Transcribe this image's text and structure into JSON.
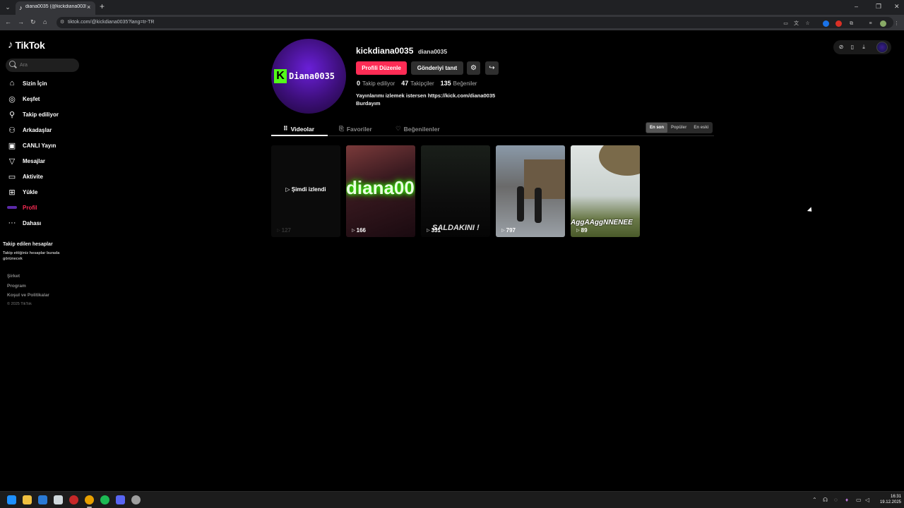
{
  "browser": {
    "tab_title": "diana0035 (@kickdiana0035) | TikTok",
    "tab_close": "×",
    "new_tab": "+",
    "url": "tiktok.com/@kickdiana0035?lang=tr-TR",
    "window_controls": [
      "–",
      "❐",
      "✕"
    ]
  },
  "sidebar": {
    "logo": "TikTok",
    "search_placeholder": "Ara",
    "items": [
      {
        "label": "Sizin İçin",
        "icon": "home-icon"
      },
      {
        "label": "Keşfet",
        "icon": "compass-icon"
      },
      {
        "label": "Takip ediliyor",
        "icon": "following-icon"
      },
      {
        "label": "Arkadaşlar",
        "icon": "friends-icon"
      },
      {
        "label": "CANLI Yayın",
        "icon": "live-icon"
      },
      {
        "label": "Mesajlar",
        "icon": "messages-icon"
      },
      {
        "label": "Aktivite",
        "icon": "activity-icon"
      },
      {
        "label": "Yükle",
        "icon": "upload-icon"
      },
      {
        "label": "Profil",
        "icon": "profile-avatar-icon",
        "active": true
      },
      {
        "label": "Dahası",
        "icon": "more-icon"
      }
    ],
    "followed_title": "Takip edilen hesaplar",
    "followed_desc": "Takip ettiğiniz hesaplar burada görünecek",
    "footer_links": [
      "Şirket",
      "Program",
      "Koşul ve Politikalar"
    ],
    "copyright": "© 2025 TikTok"
  },
  "profile": {
    "avatar_text": "Diana0035",
    "avatar_k": "K",
    "username": "kickdiana0035",
    "nickname": "diana0035",
    "edit_button": "Profili Düzenle",
    "promote_button": "Gönderiyi tanıt",
    "stats": [
      {
        "num": "0",
        "label": "Takip ediliyor"
      },
      {
        "num": "47",
        "label": "Takipçiler"
      },
      {
        "num": "135",
        "label": "Beğeniler"
      }
    ],
    "bio_line1": "Yayınlarımı izlemek istersen https://kick.com/diana0035",
    "bio_line2": "Burdayım"
  },
  "tabs": [
    {
      "label": "Videolar",
      "icon": "grid-icon",
      "active": true
    },
    {
      "label": "Favoriler",
      "icon": "bookmark-icon"
    },
    {
      "label": "Beğenilenler",
      "icon": "heart-icon"
    }
  ],
  "sort": [
    "En son",
    "Popüler",
    "En eski"
  ],
  "videos": [
    {
      "views": "127",
      "watched": "Şimdi izlendi",
      "overlay": ""
    },
    {
      "views": "166",
      "overlay": "diana00"
    },
    {
      "views": "331",
      "overlay": "SALDAKINI !"
    },
    {
      "views": "797",
      "overlay": ""
    },
    {
      "views": "89",
      "overlay": "AggAAggNNENEE"
    }
  ],
  "taskbar": {
    "time": "16:31",
    "date": "19.12.2025"
  },
  "colors": {
    "accent": "#fe2c55",
    "kick_green": "#53fc18",
    "avatar_purple": "#5b1fc0"
  }
}
